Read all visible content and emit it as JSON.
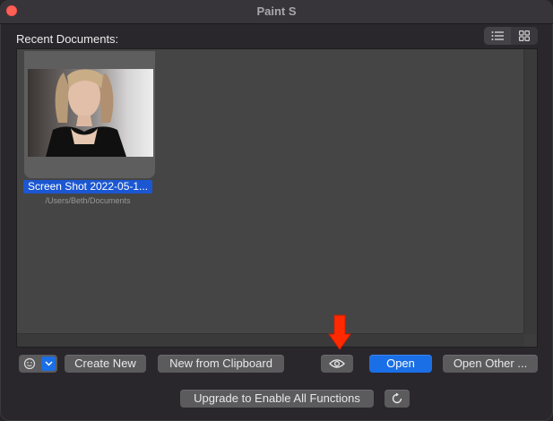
{
  "window": {
    "title": "Paint S"
  },
  "recent": {
    "label": "Recent Documents:",
    "documents": [
      {
        "name": "Screen Shot 2022-05-1...",
        "path": "/Users/Beth/Documents"
      }
    ]
  },
  "view_toggle": {
    "list_icon": "list-icon",
    "grid_icon": "grid-icon",
    "active": "list"
  },
  "buttons": {
    "create_new": "Create New",
    "new_from_clipboard": "New from Clipboard",
    "open": "Open",
    "open_other": "Open Other ...",
    "upgrade": "Upgrade to Enable All Functions"
  },
  "icons": {
    "emoji": "smiley-icon",
    "chevron": "chevron-down-icon",
    "preview": "eye-icon",
    "refresh": "refresh-icon",
    "annotation": "red-arrow-icon"
  },
  "colors": {
    "accent": "#1a6fe6",
    "selection": "#1b57d2",
    "close": "#fe5f57",
    "annotation": "#ff2a00"
  }
}
